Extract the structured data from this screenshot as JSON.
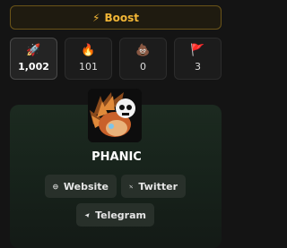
{
  "boost": {
    "icon": "lightning-icon",
    "label": "Boost"
  },
  "stats": [
    {
      "icon": "rocket-icon",
      "glyph": "🚀",
      "value": "1,002",
      "active": true
    },
    {
      "icon": "fire-icon",
      "glyph": "🔥",
      "value": "101",
      "active": false
    },
    {
      "icon": "poop-icon",
      "glyph": "💩",
      "value": "0",
      "active": false
    },
    {
      "icon": "red-flag-icon",
      "glyph": "🚩",
      "value": "3",
      "active": false
    }
  ],
  "token": {
    "name": "PHANIC",
    "avatar_icon": "hedgehog-avatar"
  },
  "links": {
    "website": "Website",
    "twitter": "Twitter",
    "telegram": "Telegram"
  },
  "colors": {
    "accent": "#f2b636",
    "card": "#1c2a20",
    "button": "#28302a"
  }
}
